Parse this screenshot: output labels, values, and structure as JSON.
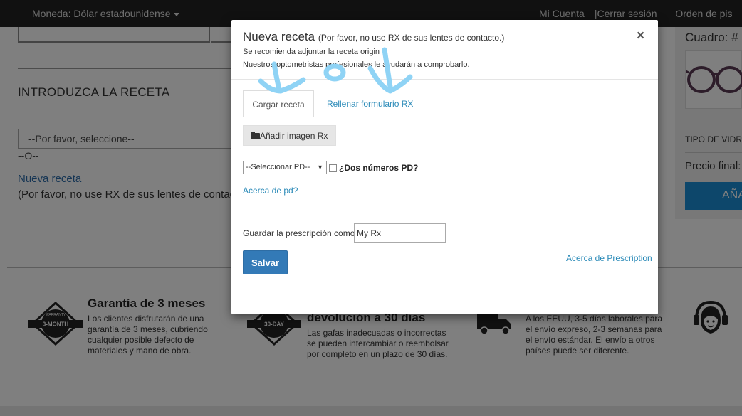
{
  "topbar": {
    "currency": "Moneda: Dólar estadounidense",
    "account": "Mi Cuenta",
    "separator": "|",
    "logout": "Cerrar sesión",
    "orders": "Orden de pis"
  },
  "page": {
    "section_title": "INTRODUZCA LA RECETA",
    "select_placeholder": "--Por favor, seleccione--",
    "or_text": "--O--",
    "new_rx_link": "Nueva receta",
    "new_rx_note": "(Por favor, no use RX de sus lentes de contact"
  },
  "sidebar": {
    "frame_label": "Cuadro: #",
    "lens_type": "TIPO DE VIDRIO",
    "final_price": "Precio final:",
    "add_button": "AÑA"
  },
  "features": [
    {
      "badge": "3-MONTH",
      "badge_top": "WARRANTY",
      "title": "Garantía de 3 meses",
      "text": "Los clientes disfrutarán de una garantía de 3 meses, cubriendo cualquier posible defecto de materiales y mano de obra."
    },
    {
      "badge": "30-DAY",
      "title": "devolución a 30 días",
      "text": "Las gafas inadecuadas o incorrectas se pueden intercambiar o reembolsar por completo en un plazo de 30 días."
    },
    {
      "text": "A los EEUU, 3-5 días laborales para el envío expreso, 2-3 semanas para el envío estándar. El envío a otros países puede ser diferente."
    }
  ],
  "modal": {
    "title": "Nueva receta",
    "title_note": "(Por favor, no use RX de sus lentes de contacto.)",
    "close": "×",
    "line1": "Se recomienda adjuntar la receta origin",
    "line2": "Nuestros optometristas profesionales le ayudarán a comprobarlo.",
    "tabs": [
      {
        "label": "Cargar receta",
        "active": true
      },
      {
        "label": "Rellenar formulario RX",
        "active": false
      }
    ],
    "add_image": "Añadir imagen Rx",
    "pd_select": "--Seleccionar PD--",
    "two_pd": "¿Dos números PD?",
    "about_pd": "Acerca de pd?",
    "save_as_label": "Guardar la prescripción como:",
    "save_as_value": "My Rx",
    "save_button": "Salvar",
    "about_rx": "Acerca de Prescription"
  },
  "colors": {
    "topbar": "#222222",
    "primary_button": "#337ab7",
    "link": "#2a8ab8",
    "cta": "#1a8fd6",
    "annotation": "#8fd3f5"
  },
  "icons": [
    "caret-down-icon",
    "close-icon",
    "folder-open-icon",
    "warranty-badge-icon",
    "return-badge-icon",
    "truck-icon",
    "support-agent-icon",
    "glasses-thumbnail"
  ]
}
